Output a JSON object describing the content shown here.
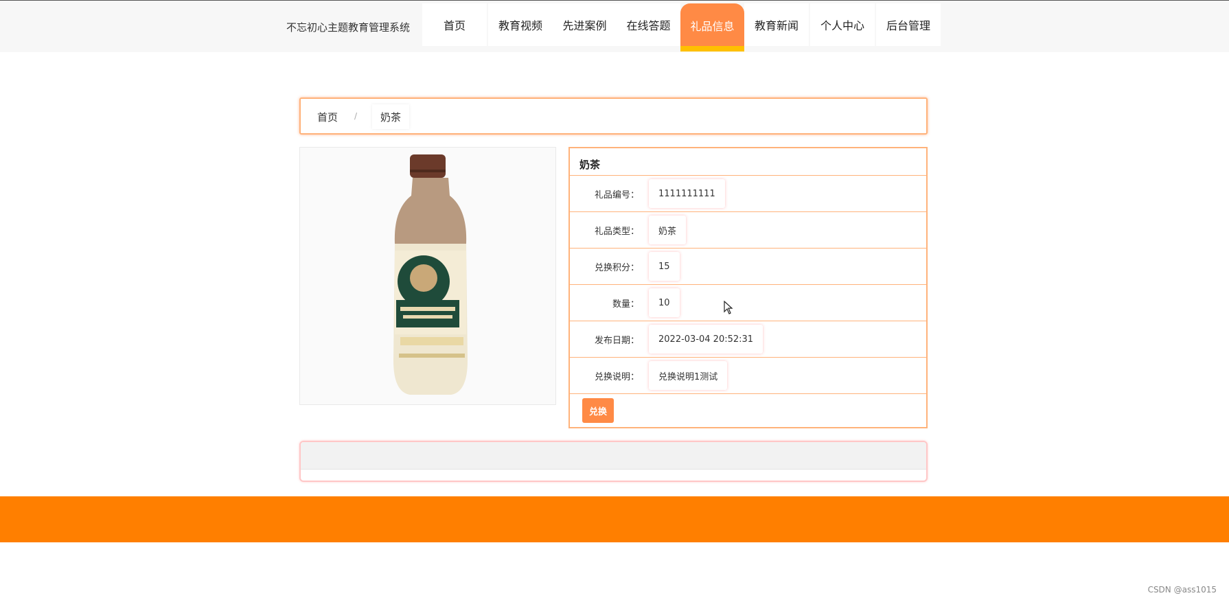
{
  "header": {
    "site_title": "不忘初心主题教育管理系统",
    "nav": [
      {
        "label": "首页"
      },
      {
        "label": "教育视频"
      },
      {
        "label": "先进案例"
      },
      {
        "label": "在线答题"
      },
      {
        "label": "礼品信息",
        "active": true
      },
      {
        "label": "教育新闻"
      },
      {
        "label": "个人中心"
      },
      {
        "label": "后台管理"
      }
    ]
  },
  "breadcrumb": {
    "home": "首页",
    "separator": "/",
    "current": "奶茶"
  },
  "product": {
    "image_icon": "milk-tea-bottle",
    "title": "奶茶",
    "fields": [
      {
        "label": "礼品编号：",
        "value": "1111111111"
      },
      {
        "label": "礼品类型：",
        "value": "奶茶"
      },
      {
        "label": "兑换积分：",
        "value": "15"
      },
      {
        "label": "数量：",
        "value": "10"
      },
      {
        "label": "发布日期：",
        "value": "2022-03-04 20:52:31"
      },
      {
        "label": "兑换说明：",
        "value": "兑换说明1测试"
      }
    ],
    "exchange_label": "兑换"
  },
  "watermark": "CSDN @ass1015",
  "colors": {
    "accent": "#ff8a45",
    "active_underline": "#ffc000",
    "footer": "#ff7f00",
    "border": "#ffb27a"
  }
}
